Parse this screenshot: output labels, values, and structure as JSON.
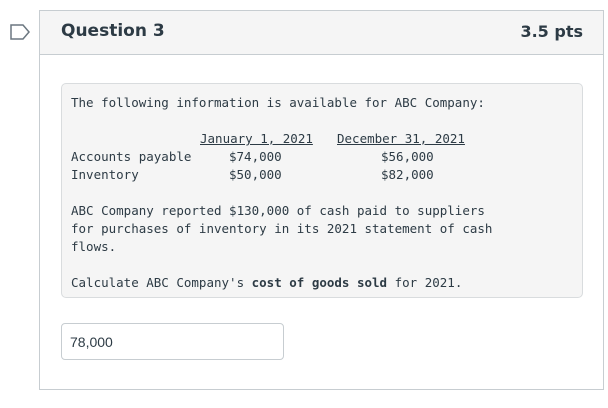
{
  "question": {
    "title": "Question 3",
    "points": "3.5 pts",
    "intro": "The following information is available for ABC Company:",
    "table": {
      "col1_header": "January 1, 2021",
      "col2_header": "December 31, 2021",
      "rows": [
        {
          "label": "Accounts payable",
          "jan": "$74,000",
          "dec": "$56,000"
        },
        {
          "label": "Inventory",
          "jan": "$50,000",
          "dec": "$82,000"
        }
      ]
    },
    "para_line1": "ABC Company reported $130,000 of cash paid to suppliers",
    "para_line2": "for purchases of inventory in its 2021 statement of cash",
    "para_line3": "flows.",
    "ask_prefix": "Calculate ABC Company's ",
    "ask_bold": "cost of goods sold",
    "ask_suffix": " for 2021.",
    "answer_value": "78,000"
  },
  "colors": {
    "text": "#2d3b45",
    "border": "#c7cdd1",
    "header_bg": "#f5f5f5"
  }
}
